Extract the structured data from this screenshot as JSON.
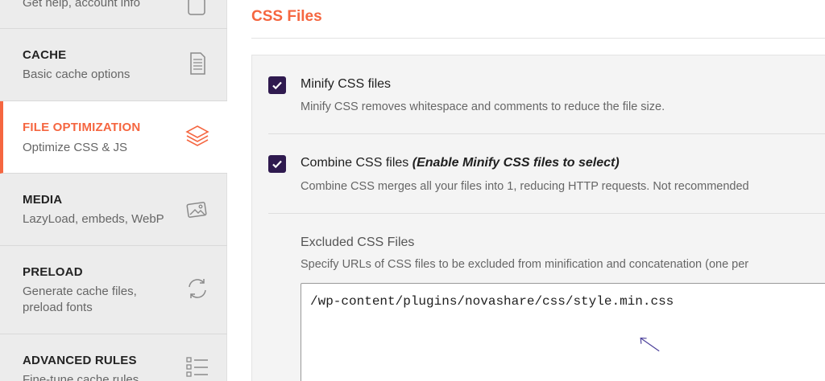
{
  "sidebar": {
    "items": [
      {
        "title": "",
        "subtitle": "Get help, account info",
        "icon": "help-icon"
      },
      {
        "title": "CACHE",
        "subtitle": "Basic cache options",
        "icon": "document-icon"
      },
      {
        "title": "FILE OPTIMIZATION",
        "subtitle": "Optimize CSS & JS",
        "icon": "layers-icon",
        "active": true
      },
      {
        "title": "MEDIA",
        "subtitle": "LazyLoad, embeds, WebP",
        "icon": "images-icon"
      },
      {
        "title": "PRELOAD",
        "subtitle": "Generate cache files,",
        "subtitle2": "preload fonts",
        "icon": "refresh-icon"
      },
      {
        "title": "ADVANCED RULES",
        "subtitle": "Fine-tune cache rules",
        "icon": "list-icon"
      }
    ]
  },
  "main": {
    "section_title": "CSS Files",
    "options": [
      {
        "label": "Minify CSS files",
        "label_note": "",
        "description": "Minify CSS removes whitespace and comments to reduce the file size.",
        "checked": true
      },
      {
        "label": "Combine CSS files",
        "label_note": "(Enable Minify CSS files to select)",
        "description": "Combine CSS merges all your files into 1, reducing HTTP requests. Not recommended",
        "checked": true
      }
    ],
    "excluded": {
      "label": "Excluded CSS Files",
      "description": "Specify URLs of CSS files to be excluded from minification and concatenation (one per",
      "value": "/wp-content/plugins/novashare/css/style.min.css"
    }
  },
  "colors": {
    "accent": "#f56640",
    "checkbox": "#2f1a4f",
    "arrow": "#4b3f9a"
  }
}
